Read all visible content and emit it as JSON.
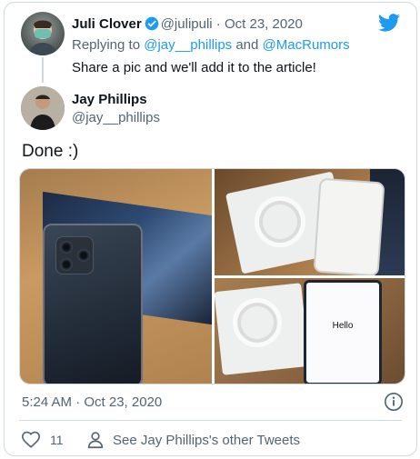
{
  "reply_tweet": {
    "author_name": "Juli Clover",
    "handle": "@julipuli",
    "separator": "·",
    "date": "Oct 23, 2020",
    "replying_prefix": "Replying to",
    "replying_to_1": "@jay__phillips",
    "replying_and": "and",
    "replying_to_2": "@MacRumors",
    "text": "Share a pic and we'll add it to the article!"
  },
  "main_tweet": {
    "author_name": "Jay Phillips",
    "handle": "@jay__phillips",
    "text": "Done :)",
    "media": {
      "screen_text": "Hello"
    },
    "timestamp": "5:24 AM · Oct 23, 2020",
    "like_count": "11",
    "other_tweets_label": "See Jay Phillips's other Tweets"
  },
  "colors": {
    "accent": "#1d9bf0",
    "muted": "#536471",
    "border": "#cfd9de",
    "like_icon": "#536471"
  },
  "icons": {
    "brand": "twitter-bird-icon",
    "verified": "verified-badge-icon",
    "info": "info-icon",
    "like": "heart-icon",
    "profile": "person-icon"
  }
}
